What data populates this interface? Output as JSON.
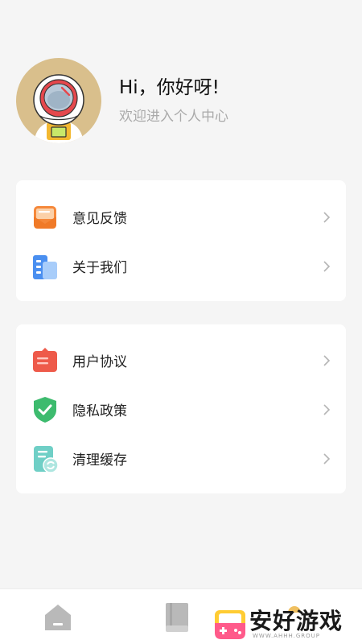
{
  "profile": {
    "greeting": "Hi，你好呀!",
    "subtitle": "欢迎进入个人中心",
    "avatar_icon": "astronaut-avatar"
  },
  "card1": {
    "items": [
      {
        "label": "意见反馈",
        "icon": "feedback-envelope-icon",
        "color": "#f5883a"
      },
      {
        "label": "关于我们",
        "icon": "buildings-icon",
        "color": "#4a8ff0"
      }
    ]
  },
  "card2": {
    "items": [
      {
        "label": "用户协议",
        "icon": "agreement-icon",
        "color": "#ee5a4a"
      },
      {
        "label": "隐私政策",
        "icon": "shield-check-icon",
        "color": "#3dbb6e"
      },
      {
        "label": "清理缓存",
        "icon": "clear-cache-icon",
        "color": "#6fcfc6"
      }
    ]
  },
  "tabbar": {
    "tabs": [
      {
        "icon": "home-icon"
      },
      {
        "icon": "book-icon"
      },
      {
        "icon": "profile-icon"
      }
    ]
  },
  "watermark": {
    "text": "安好游戏",
    "sub": "WWW.AHHH.GROUP"
  }
}
